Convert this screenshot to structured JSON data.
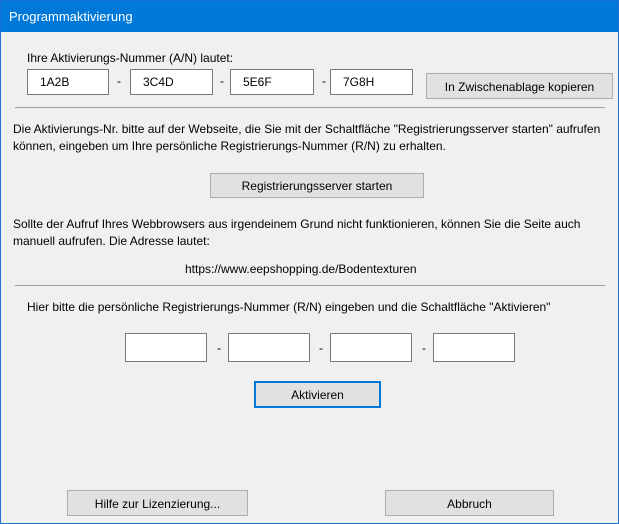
{
  "window": {
    "title": "Programmaktivierung"
  },
  "activation": {
    "label": "Ihre Aktivierungs-Nummer (A/N) lautet:",
    "parts": [
      "1A2B",
      "3C4D",
      "5E6F",
      "7G8H"
    ],
    "separator": "-",
    "copy_button": "In Zwischenablage kopieren"
  },
  "instructions": {
    "text": "Die Aktivierungs-Nr. bitte auf der Webseite, die Sie mit der Schaltfläche \"Registrierungsserver starten\" aufrufen können, eingeben um Ihre persönliche Registrierungs-Nummer (R/N) zu erhalten.",
    "server_button": "Registrierungsserver starten",
    "manual_text": "Sollte  der Aufruf Ihres Webbrowsers aus irgendeinem Grund nicht funktionieren, können Sie die Seite auch manuell aufrufen. Die Adresse lautet:",
    "url": "https://www.eepshopping.de/Bodentexturen"
  },
  "registration": {
    "label": "Hier bitte die persönliche Registrierungs-Nummer (R/N) eingeben und die Schaltfläche \"Aktivieren\"",
    "fields": [
      "",
      "",
      "",
      ""
    ],
    "separator": "-",
    "activate_button": "Aktivieren"
  },
  "footer": {
    "help_button": "Hilfe zur Lizenzierung...",
    "cancel_button": "Abbruch"
  }
}
